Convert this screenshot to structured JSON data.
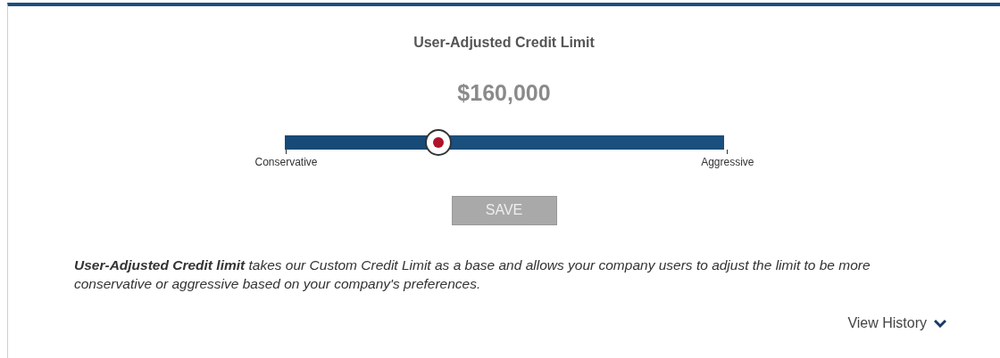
{
  "panel": {
    "title": "User-Adjusted Credit Limit",
    "amount": "$160,000"
  },
  "slider": {
    "level": 0.35,
    "min_label": "Conservative",
    "max_label": "Aggressive"
  },
  "save_button": {
    "label": "SAVE",
    "disabled": true
  },
  "description": "**User-Adjusted Credit limit** takes our Custom Credit Limit as a base and allows your company users to adjust the limit to be more conservative or aggressive based on your company's preferences.",
  "view_history": {
    "label": "View History",
    "expanded": false
  }
}
